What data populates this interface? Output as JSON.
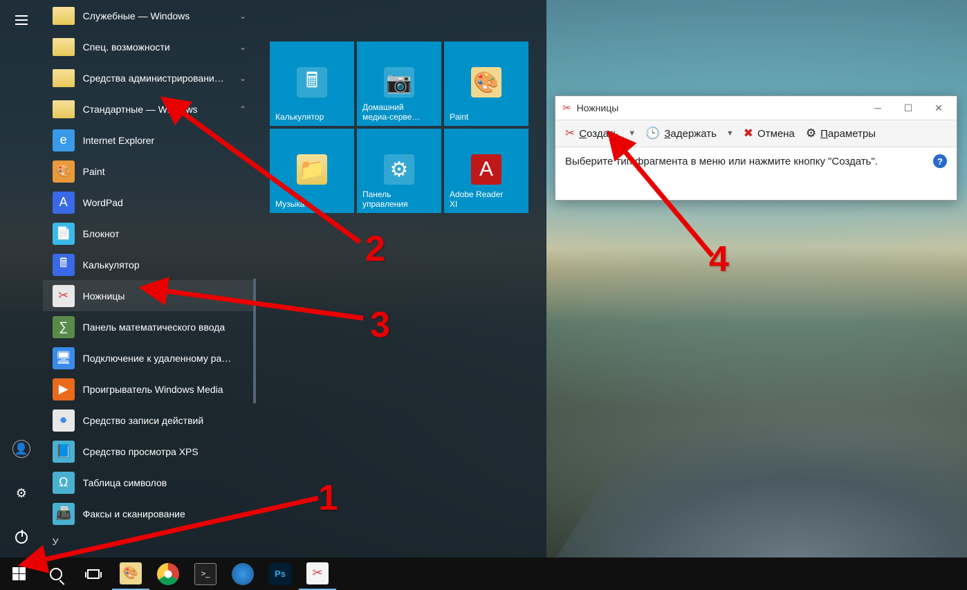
{
  "start_rail": {
    "hamburger_name": "menu-button",
    "user_name": "user-account-button",
    "settings_name": "settings-button",
    "power_name": "power-button"
  },
  "app_list": {
    "folders": [
      {
        "label": "Служебные — Windows",
        "expanded": false
      },
      {
        "label": "Спец. возможности",
        "expanded": false
      },
      {
        "label": "Средства администрировани…",
        "expanded": false
      },
      {
        "label": "Стандартные — Windows",
        "expanded": true
      }
    ],
    "apps": [
      {
        "label": "Internet Explorer",
        "cls": "ie",
        "glyph": "e"
      },
      {
        "label": "Paint",
        "cls": "paint",
        "glyph": "🎨"
      },
      {
        "label": "WordPad",
        "cls": "wordpad",
        "glyph": "A"
      },
      {
        "label": "Блокнот",
        "cls": "notepad",
        "glyph": "📄"
      },
      {
        "label": "Калькулятор",
        "cls": "calc",
        "glyph": "🖩"
      },
      {
        "label": "Ножницы",
        "cls": "snip",
        "glyph": "✂",
        "highlight": true
      },
      {
        "label": "Панель математического ввода",
        "cls": "math",
        "glyph": "∑"
      },
      {
        "label": "Подключение к удаленному ра…",
        "cls": "rdp",
        "glyph": "🖥"
      },
      {
        "label": "Проигрыватель Windows Media",
        "cls": "wmp",
        "glyph": "▶"
      },
      {
        "label": "Средство записи действий",
        "cls": "steps",
        "glyph": "⏺"
      },
      {
        "label": "Средство просмотра XPS",
        "cls": "xps",
        "glyph": "📘"
      },
      {
        "label": "Таблица символов",
        "cls": "charmap",
        "glyph": "Ω"
      },
      {
        "label": "Факсы и сканирование",
        "cls": "fax",
        "glyph": "📠"
      }
    ],
    "letter_header": "У"
  },
  "tiles": [
    {
      "label": "Калькулятор",
      "glyph": "🖩",
      "cls": ""
    },
    {
      "label": "Домашний\nмедиа-серве…",
      "glyph": "📷",
      "cls": ""
    },
    {
      "label": "Paint",
      "glyph": "🎨",
      "cls": "t-paint"
    },
    {
      "label": "Музыка",
      "glyph": "📁",
      "cls": "t-folder"
    },
    {
      "label": "Панель\nуправления",
      "glyph": "⚙",
      "cls": ""
    },
    {
      "label": "Adobe Reader\nXI",
      "glyph": "A",
      "cls": "t-adobe"
    }
  ],
  "snipping_tool": {
    "title": "Ножницы",
    "create": "Создать",
    "delay": "Задержать",
    "cancel": "Отмена",
    "options": "Параметры",
    "hint": "Выберите тип фрагмента в меню или нажмите кнопку \"Создать\"."
  },
  "annotations": {
    "n1": "1",
    "n2": "2",
    "n3": "3",
    "n4": "4"
  }
}
